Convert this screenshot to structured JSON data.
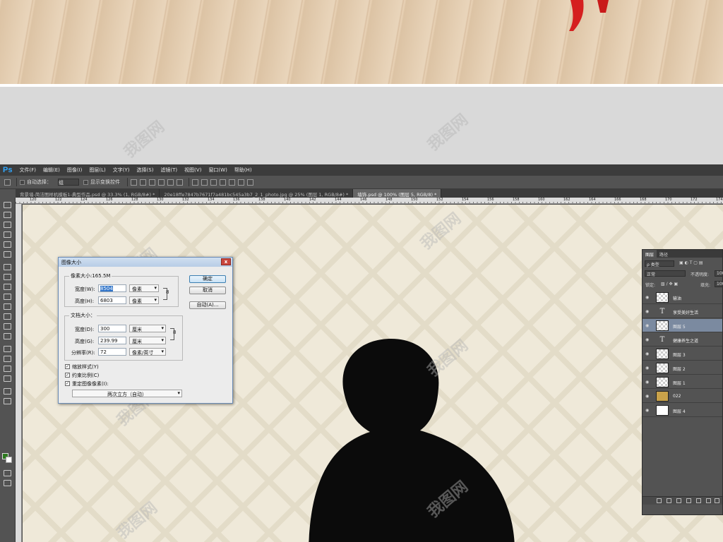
{
  "menu": {
    "logo": "Ps",
    "items": [
      "文件(F)",
      "编辑(E)",
      "图像(I)",
      "图层(L)",
      "文字(Y)",
      "选择(S)",
      "滤镜(T)",
      "视图(V)",
      "窗口(W)",
      "帮助(H)"
    ]
  },
  "options_bar": {
    "auto_select_label": "自动选择：",
    "auto_select_value": "组",
    "show_transform_label": "显示变换控件"
  },
  "tabs": [
    {
      "label": "背景墙-简洁图样机模板1-典型作品.psd @ 33.3% (1, RGB/8#) *",
      "active": false
    },
    {
      "label": "20e18ffe7847b7671f7a481bc545a3b7_2_1_photo.jpg @ 25% (图层 1, RGB/8#) *",
      "active": false
    },
    {
      "label": "墙饰.psd @ 100% (图层 5, RGB/8) *",
      "active": true
    }
  ],
  "ruler_numbers": [
    "120",
    "122",
    "124",
    "126",
    "128",
    "130",
    "132",
    "134",
    "136",
    "138",
    "140",
    "142",
    "144",
    "146",
    "148",
    "150",
    "152",
    "154",
    "156",
    "158",
    "160",
    "162",
    "164",
    "166",
    "168",
    "170",
    "172",
    "174"
  ],
  "watermark": "我图网",
  "dialog": {
    "title": "图像大小",
    "close": "x",
    "pixel_size": "像素大小:165.5M",
    "width_label": "宽度(W):",
    "width_value": "8504",
    "width_unit": "像素",
    "height_label": "高度(H):",
    "height_value": "6803",
    "height_unit": "像素",
    "doc_size": "文档大小：",
    "doc_width_label": "宽度(D):",
    "doc_width_value": "300",
    "doc_width_unit": "厘米",
    "doc_height_label": "高度(G):",
    "doc_height_value": "239.99",
    "doc_height_unit": "厘米",
    "resolution_label": "分辨率(R):",
    "resolution_value": "72",
    "resolution_unit": "像素/英寸",
    "scale_styles": "缩放样式(Y)",
    "constrain": "约束比例(C)",
    "resample": "重定图像像素(I):",
    "resample_method": "两次立方（自动）",
    "ok": "确定",
    "cancel": "取消",
    "auto": "自动(A)..."
  },
  "layers_panel": {
    "tab_layers": "图层",
    "tab_paths": "路径",
    "filter_label": "ρ 类型",
    "blend_mode": "正常",
    "opacity_label": "不透明度:",
    "opacity_value": "100",
    "lock_label": "锁定:",
    "fill_label": "填充:",
    "fill_value": "100",
    "layers": [
      {
        "name": "输油",
        "thumb": "checker",
        "selected": false
      },
      {
        "name": "享受美好生活",
        "thumb": "text",
        "selected": false
      },
      {
        "name": "图层 5",
        "thumb": "checker",
        "selected": true
      },
      {
        "name": "健康养生之道",
        "thumb": "text",
        "selected": false
      },
      {
        "name": "图层 3",
        "thumb": "checker",
        "selected": false
      },
      {
        "name": "图层 2",
        "thumb": "checker",
        "selected": false
      },
      {
        "name": "图层 1",
        "thumb": "checker",
        "selected": false
      },
      {
        "name": "022",
        "thumb": "gold",
        "selected": false
      },
      {
        "name": "图层 4",
        "thumb": "white",
        "selected": false
      }
    ]
  },
  "colors": {
    "foreground": "#2d7a1f",
    "background": "#ffffff",
    "canvas": "#efe9d9",
    "ps_logo": "#31a8ff"
  }
}
